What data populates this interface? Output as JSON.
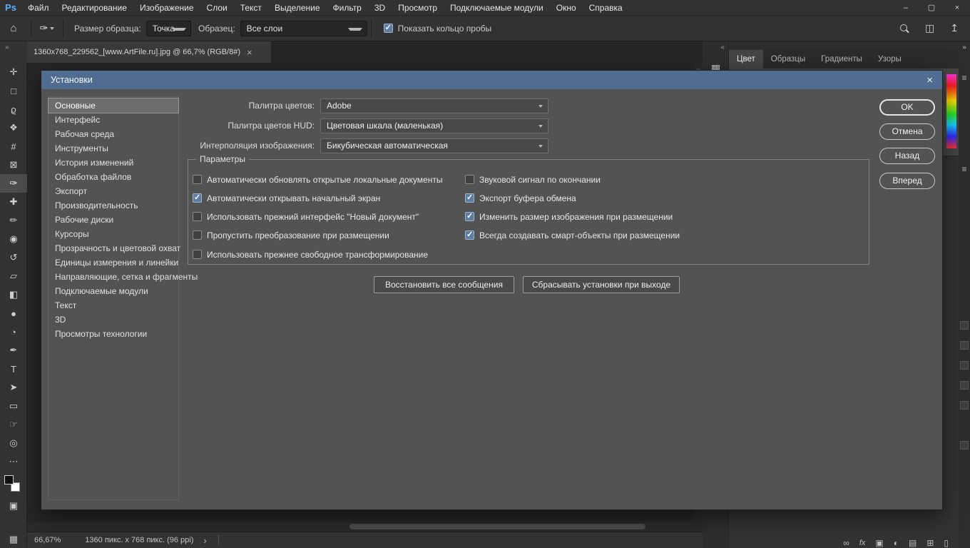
{
  "colors": {
    "titlebar_blue": "#4e6d90",
    "checkbox_accent": "#5d7da1",
    "ps_logo_blue": "#55b1ff",
    "dialog_bg": "#535353",
    "ui_dark": "#323232"
  },
  "menubar": {
    "logo": "Ps",
    "items": [
      "Файл",
      "Редактирование",
      "Изображение",
      "Слои",
      "Текст",
      "Выделение",
      "Фильтр",
      "3D",
      "Просмотр",
      "Подключаемые модули",
      "Окно",
      "Справка"
    ],
    "window_controls": [
      {
        "name": "minimize",
        "glyph": "–"
      },
      {
        "name": "maximize",
        "glyph": "▢"
      },
      {
        "name": "close",
        "glyph": "×"
      }
    ]
  },
  "optionsbar": {
    "home_icon": "⌂",
    "tool_icon": "✑",
    "sample_size_label": "Размер образца:",
    "sample_size_value": "Точка",
    "sample_label": "Образец:",
    "sample_value": "Все слои",
    "ring_checkbox": {
      "label": "Показать кольцо пробы",
      "checked": true
    },
    "layout_icon": "◫",
    "share_icon": "↥"
  },
  "document_tab": {
    "title": "1360x768_229562_[www.ArtFile.ru].jpg @ 66,7% (RGB/8#)",
    "close_glyph": "×"
  },
  "toolbar": {
    "collapse_glyph": "»",
    "tools": [
      {
        "name": "move-tool",
        "glyph": "✛",
        "selected": false
      },
      {
        "name": "marquee-tool",
        "glyph": "□",
        "selected": false
      },
      {
        "name": "lasso-tool",
        "glyph": "ϱ",
        "selected": false
      },
      {
        "name": "quick-selection-tool",
        "glyph": "❖",
        "selected": false
      },
      {
        "name": "crop-tool",
        "glyph": "#",
        "selected": false
      },
      {
        "name": "frame-tool",
        "glyph": "⊠",
        "selected": false
      },
      {
        "name": "eyedropper-tool",
        "glyph": "✑",
        "selected": true
      },
      {
        "name": "healing-brush-tool",
        "glyph": "✚",
        "selected": false
      },
      {
        "name": "brush-tool",
        "glyph": "✏",
        "selected": false
      },
      {
        "name": "clone-stamp-tool",
        "glyph": "◉",
        "selected": false
      },
      {
        "name": "history-brush-tool",
        "glyph": "↺",
        "selected": false
      },
      {
        "name": "eraser-tool",
        "glyph": "▱",
        "selected": false
      },
      {
        "name": "gradient-tool",
        "glyph": "◧",
        "selected": false
      },
      {
        "name": "blur-tool",
        "glyph": "●",
        "selected": false
      },
      {
        "name": "dodge-tool",
        "glyph": "◔",
        "selected": false
      },
      {
        "name": "pen-tool",
        "glyph": "✒",
        "selected": false
      },
      {
        "name": "type-tool",
        "glyph": "T",
        "selected": false
      },
      {
        "name": "path-selection-tool",
        "glyph": "➤",
        "selected": false
      },
      {
        "name": "rectangle-tool",
        "glyph": "▭",
        "selected": false
      },
      {
        "name": "hand-tool",
        "glyph": "☞",
        "selected": false
      },
      {
        "name": "zoom-tool",
        "glyph": "◎",
        "selected": false
      },
      {
        "name": "edit-toolbar",
        "glyph": "⋯",
        "selected": false
      }
    ],
    "quick_mask_glyph": "▣",
    "screen_mode_glyph": "▦"
  },
  "dialog": {
    "title": "Установки",
    "close_glyph": "×",
    "sidebar": [
      {
        "label": "Основные",
        "selected": true
      },
      {
        "label": "Интерфейс",
        "selected": false
      },
      {
        "label": "Рабочая среда",
        "selected": false
      },
      {
        "label": "Инструменты",
        "selected": false
      },
      {
        "label": "История изменений",
        "selected": false
      },
      {
        "label": "Обработка файлов",
        "selected": false
      },
      {
        "label": "Экспорт",
        "selected": false
      },
      {
        "label": "Производительность",
        "selected": false
      },
      {
        "label": "Рабочие диски",
        "selected": false
      },
      {
        "label": "Курсоры",
        "selected": false
      },
      {
        "label": "Прозрачность и цветовой охват",
        "selected": false
      },
      {
        "label": "Единицы измерения и линейки",
        "selected": false
      },
      {
        "label": "Направляющие, сетка и фрагменты",
        "selected": false
      },
      {
        "label": "Подключаемые модули",
        "selected": false
      },
      {
        "label": "Текст",
        "selected": false
      },
      {
        "label": "3D",
        "selected": false
      },
      {
        "label": "Просмотры технологии",
        "selected": false
      }
    ],
    "fields": [
      {
        "label": "Палитра цветов:",
        "value": "Adobe"
      },
      {
        "label": "Палитра цветов HUD:",
        "value": "Цветовая шкала (маленькая)"
      },
      {
        "label": "Интерполяция изображения:",
        "value": "Бикубическая автоматическая"
      }
    ],
    "options_group": {
      "legend": "Параметры",
      "left": [
        {
          "label": "Автоматически обновлять открытые локальные документы",
          "checked": false
        },
        {
          "label": "Автоматически открывать начальный экран",
          "checked": true
        },
        {
          "label": "Использовать прежний интерфейс \"Новый документ\"",
          "checked": false
        },
        {
          "label": "Пропустить преобразование при размещении",
          "checked": false
        },
        {
          "label": "Использовать прежнее свободное трансформирование",
          "checked": false
        }
      ],
      "right": [
        {
          "label": "Звуковой сигнал по окончании",
          "checked": false
        },
        {
          "label": "Экспорт буфера обмена",
          "checked": true
        },
        {
          "label": "Изменить размер изображения при размещении",
          "checked": true
        },
        {
          "label": "Всегда создавать смарт-объекты при размещении",
          "checked": true
        }
      ]
    },
    "message_buttons": [
      "Восстановить все сообщения",
      "Сбрасывать установки при выходе"
    ],
    "action_buttons": [
      "OK",
      "Отмена",
      "Назад",
      "Вперед"
    ]
  },
  "panels": {
    "collapse_left_glyph": "«",
    "collapse_right_glyph": "»",
    "strip_icons": [
      {
        "name": "panel-thumb-1",
        "glyph": "▦"
      },
      {
        "name": "panel-thumb-2",
        "glyph": "▥"
      }
    ],
    "tabs": [
      {
        "label": "Цвет",
        "active": true
      },
      {
        "label": "Образцы",
        "active": false
      },
      {
        "label": "Градиенты",
        "active": false
      },
      {
        "label": "Узоры",
        "active": false
      }
    ],
    "menu_icon": "≡",
    "layer_icons": [
      {
        "name": "link-icon",
        "glyph": "∞"
      },
      {
        "name": "fx-icon",
        "glyph": "fx"
      },
      {
        "name": "mask-icon",
        "glyph": "▣"
      },
      {
        "name": "adjustment-icon",
        "glyph": "◐"
      },
      {
        "name": "group-icon",
        "glyph": "▤"
      },
      {
        "name": "new-layer-icon",
        "glyph": "⊞"
      },
      {
        "name": "trash-icon",
        "glyph": "▯"
      }
    ]
  },
  "statusbar": {
    "zoom": "66,67%",
    "doc_info": "1360 пикс. x 768 пикс. (96 ppi)",
    "chevron": "›"
  }
}
